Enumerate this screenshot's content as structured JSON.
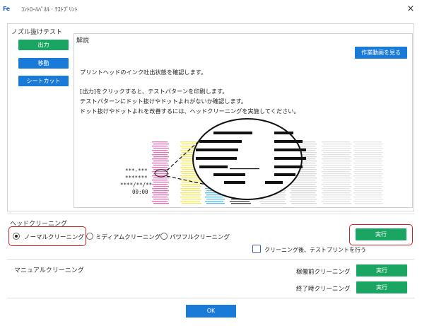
{
  "window": {
    "logo_text": "Fe",
    "title": "ｺﾝﾄﾛｰﾙﾊﾟﾈﾙ · ﾃｽﾄﾌﾟﾘﾝﾄ",
    "close_glyph": "×"
  },
  "nozzle_test": {
    "section_label": "ノズル抜けテスト",
    "output_button": "出力",
    "move_button": "移動",
    "sheet_cut_button": "シートカット"
  },
  "explanation": {
    "title": "解説",
    "video_button": "作業動画を見る",
    "lines": [
      "プリントヘッドのインク吐出状態を確認します。",
      "[出力]をクリックすると、テストパターンを印刷します。",
      "テストパターンにドット抜けやドットよれがないか確認します。",
      "ドット抜けやドットよれを改善するには、ヘッドクリーニングを実施してください。"
    ],
    "pattern_text": [
      "***-***",
      "*******",
      "****/**/**",
      "00:00"
    ]
  },
  "head_cleaning": {
    "section_label": "ヘッドクリーニング",
    "options": [
      {
        "label": "ノーマルクリーニング",
        "selected": true
      },
      {
        "label": "ミディアムクリーニング",
        "selected": false
      },
      {
        "label": "パワフルクリーニング",
        "selected": false
      }
    ],
    "execute_button": "実行",
    "test_print_after_label": "クリーニング後、テストプリントを行う"
  },
  "manual_cleaning": {
    "section_label": "マニュアルクリーニング",
    "before_label": "稼働前クリーニング",
    "before_button": "実行",
    "after_label": "終了時クリーニング",
    "after_button": "実行"
  },
  "footer": {
    "ok_button": "OK"
  },
  "colors": {
    "green": "#1aa562",
    "blue": "#1a7ad8",
    "highlight_red": "#d62020",
    "magenta": "#e23ea0",
    "yellow": "#f1e32a",
    "cyan": "#27a9e0",
    "black": "#111111"
  }
}
